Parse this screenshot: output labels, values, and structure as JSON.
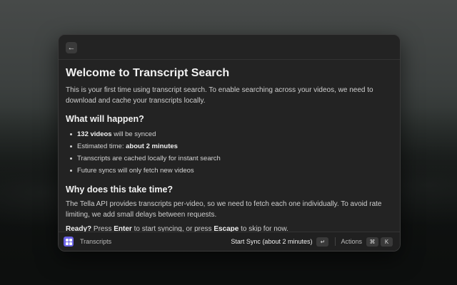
{
  "window": {
    "back_icon": "arrow-left-icon",
    "title": "Welcome to Transcript Search",
    "intro": "This is your first time using transcript search. To enable searching across your videos, we need to download and cache your transcripts locally.",
    "section1": {
      "heading": "What will happen?",
      "items": [
        {
          "bold": "132 videos",
          "rest": " will be synced"
        },
        {
          "pre": "Estimated time: ",
          "bold": "about 2 minutes"
        },
        {
          "text": "Transcripts are cached locally for instant search"
        },
        {
          "text": "Future syncs will only fetch new videos"
        }
      ]
    },
    "section2": {
      "heading": "Why does this take time?",
      "body": "The Tella API provides transcripts per-video, so we need to fetch each one individually. To avoid rate limiting, we add small delays between requests.",
      "ready": {
        "b1": "Ready?",
        "t1": " Press ",
        "b2": "Enter",
        "t2": " to start syncing, or press ",
        "b3": "Escape",
        "t3": " to skip for now."
      }
    }
  },
  "footer": {
    "app_name": "Transcripts",
    "primary_action": "Start Sync (about 2 minutes)",
    "enter_key": "↵",
    "actions_label": "Actions",
    "cmd_key": "⌘",
    "k_key": "K"
  }
}
